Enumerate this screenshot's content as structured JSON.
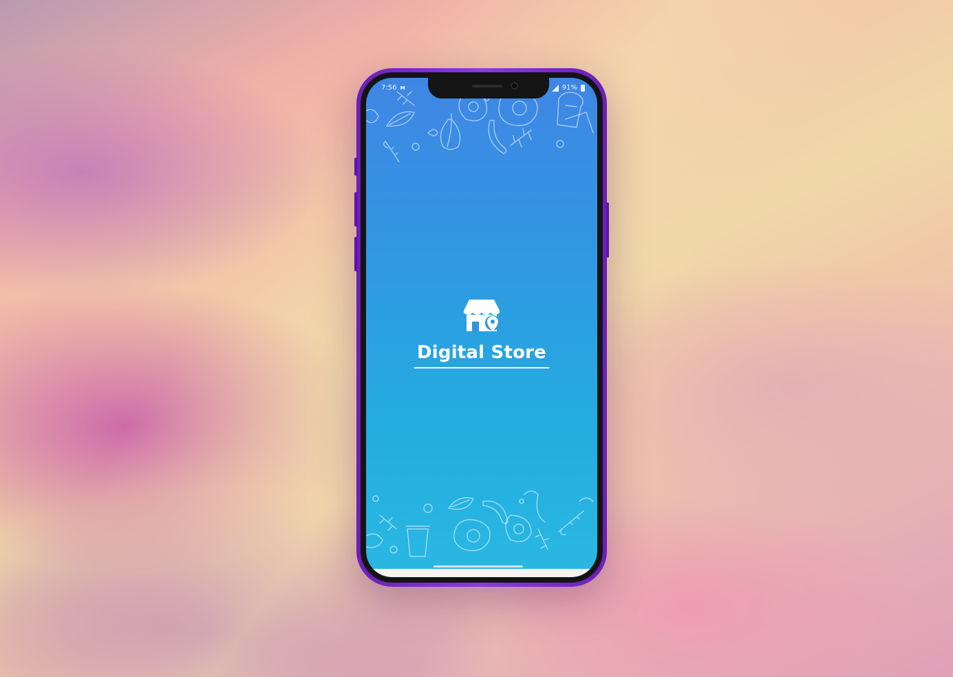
{
  "status_bar": {
    "time": "7:56",
    "notification_icon": "m-icon",
    "battery": "91%"
  },
  "splash": {
    "logo_icon": "store-location-icon",
    "title": "Digital Store"
  },
  "colors": {
    "screen_top": "#3f86e4",
    "screen_bottom": "#2ab8e2",
    "phone_frame": "#7a2fd0",
    "text": "#ffffff"
  }
}
